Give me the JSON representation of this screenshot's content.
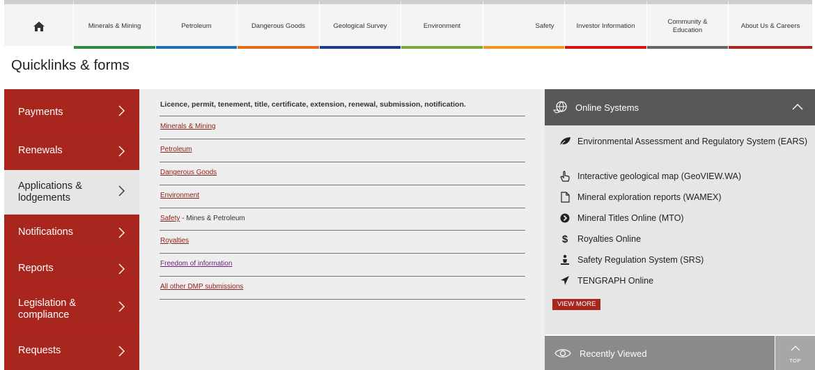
{
  "nav": {
    "home_icon": "home-icon",
    "items": [
      {
        "label": "Minerals & Mining",
        "color": "#2f8a4a"
      },
      {
        "label": "Petroleum",
        "color": "#1e6fb6"
      },
      {
        "label": "Dangerous Goods",
        "color": "#e36a1a"
      },
      {
        "label": "Geological Survey",
        "color": "#1a3c8c"
      },
      {
        "label": "Environment",
        "color": "#79a83b"
      },
      {
        "label": "Safety",
        "color": "#ec9a1a"
      },
      {
        "label": "Investor Information",
        "color": "#d6121a"
      },
      {
        "label": "Community & Education",
        "color": "#666666"
      },
      {
        "label": "About Us & Careers",
        "color": "#a8261d"
      }
    ]
  },
  "page": {
    "title": "Quicklinks & forms"
  },
  "sidebar": {
    "items": [
      {
        "label": "Payments",
        "active": false
      },
      {
        "label": "Renewals",
        "active": false
      },
      {
        "label": "Applications & lodgements",
        "active": true
      },
      {
        "label": "Notifications",
        "active": false
      },
      {
        "label": "Reports",
        "active": false
      },
      {
        "label": "Legislation & compliance",
        "active": false
      },
      {
        "label": "Requests",
        "active": false
      }
    ]
  },
  "main": {
    "intro": "Licence, permit, tenement, title, certificate, extension, renewal, submission, notification.",
    "links": [
      {
        "label": "Minerals & Mining",
        "suffix": ""
      },
      {
        "label": "Petroleum",
        "suffix": ""
      },
      {
        "label": "Dangerous Goods",
        "suffix": ""
      },
      {
        "label": "Environment",
        "suffix": ""
      },
      {
        "label": "Safety",
        "suffix": " - Mines & Petroleum"
      },
      {
        "label": "Royalties",
        "suffix": ""
      },
      {
        "label": "Freedom of information",
        "suffix": ""
      },
      {
        "label": "All other DMP submissions",
        "suffix": ""
      }
    ]
  },
  "online_systems": {
    "title": "Online Systems",
    "items": [
      {
        "label": "Environmental Assessment and Regulatory System (EARS)",
        "icon": "leaf-icon"
      },
      {
        "label": "Interactive geological map (GeoVIEW.WA)",
        "icon": "pointer-hand-icon"
      },
      {
        "label": "Mineral exploration reports (WAMEX)",
        "icon": "document-icon"
      },
      {
        "label": "Mineral Titles Online (MTO)",
        "icon": "arrow-circle-icon"
      },
      {
        "label": "Royalties Online",
        "icon": "dollar-icon"
      },
      {
        "label": "Safety Regulation System (SRS)",
        "icon": "worker-icon"
      },
      {
        "label": "TENGRAPH Online",
        "icon": "location-arrow-icon"
      }
    ],
    "view_more": "VIEW MORE"
  },
  "recently_viewed": {
    "title": "Recently Viewed"
  },
  "top_button": {
    "label": "TOP"
  },
  "colors": {
    "accent_red": "#a8261d",
    "panel_dark": "#585858",
    "panel_light": "#e6e6e6"
  }
}
